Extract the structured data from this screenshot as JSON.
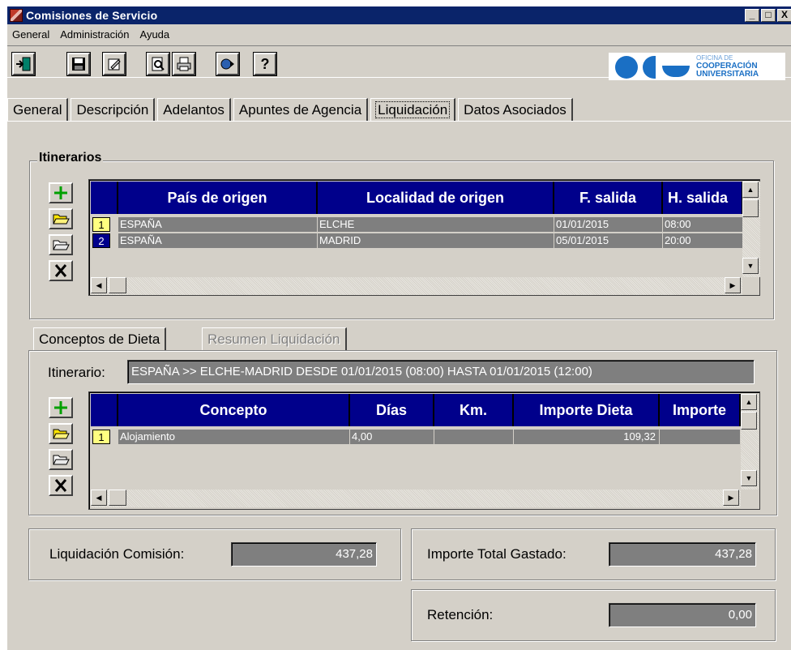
{
  "window": {
    "title": "Comisiones de Servicio",
    "btn_min": "_",
    "btn_max": "□",
    "btn_close": "X"
  },
  "menu": [
    "General",
    "Administración",
    "Ayuda"
  ],
  "toolbar": {
    "buttons": [
      "exit-icon",
      "save-icon",
      "edit-icon",
      "print-preview-icon",
      "print-icon",
      "refresh-icon",
      "help-icon"
    ],
    "help_glyph": "?"
  },
  "logo": {
    "line1": "OFICINA DE",
    "line2": "COOPERACIÓN",
    "line3": "UNIVERSITARIA",
    "color": "#1a6fc4"
  },
  "tabs": [
    "General",
    "Descripción",
    "Adelantos",
    "Apuntes de Agencia",
    "Liquidación",
    "Datos Asociados"
  ],
  "active_tab": "Liquidación",
  "itinerarios": {
    "title": "Itinerarios",
    "columns": [
      "País de origen",
      "Localidad de origen",
      "F. salida",
      "H. salida"
    ],
    "rows": [
      {
        "num": "1",
        "pais": "ESPAÑA",
        "localidad": "ELCHE",
        "fecha": "01/01/2015",
        "hora": "08:00"
      },
      {
        "num": "2",
        "pais": "ESPAÑA",
        "localidad": "MADRID",
        "fecha": "05/01/2015",
        "hora": "20:00"
      }
    ]
  },
  "inner_tabs": [
    "Conceptos de Dieta",
    "Resumen Liquidación"
  ],
  "dieta": {
    "itinerario_label": "Itinerario:",
    "itinerario_value": "ESPAÑA >> ELCHE-MADRID DESDE 01/01/2015 (08:00) HASTA 01/01/2015 (12:00)",
    "columns": [
      "Concepto",
      "Días",
      "Km.",
      "Importe Dieta",
      "Importe"
    ],
    "rows": [
      {
        "num": "1",
        "concepto": "Alojamiento",
        "dias": "4,00",
        "km": "",
        "importe_dieta": "109,32",
        "importe": ""
      }
    ]
  },
  "totals": {
    "liquidacion_label": "Liquidación Comisión:",
    "liquidacion_value": "437,28",
    "total_gastado_label": "Importe Total Gastado:",
    "total_gastado_value": "437,28",
    "retencion_label": "Retención:",
    "retencion_value": "0,00"
  },
  "colors": {
    "titlebar": "#0a246a",
    "grid_header": "#00008b",
    "cell": "#7f7f7f",
    "row_selected": "#ffff80",
    "face": "#d4d0c8"
  }
}
